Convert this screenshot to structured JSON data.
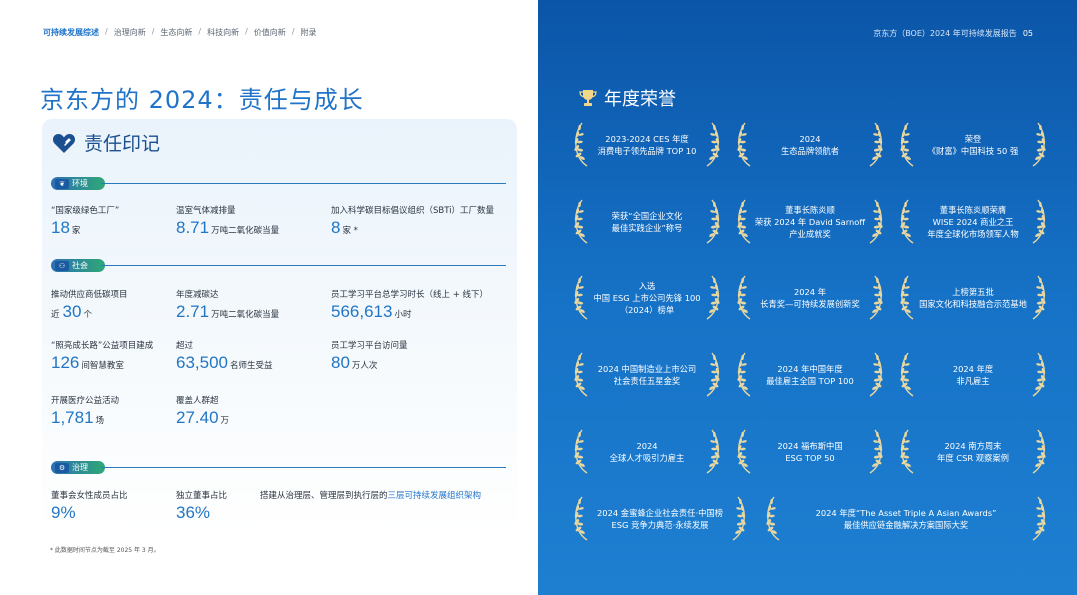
{
  "breadcrumb": {
    "items": [
      "可持续发展综述",
      "治理向新",
      "生态向新",
      "科技向新",
      "价值向新",
      "附录"
    ],
    "separator": "/"
  },
  "page_title": "京东方的 2024：责任与成长",
  "panel": {
    "title": "责任印记",
    "sections": {
      "env": {
        "label": "环境",
        "stats": [
          {
            "label": "“国家级绿色工厂”",
            "value": "18",
            "unit": "家"
          },
          {
            "label": "温室气体减排量",
            "value": "8.71",
            "unit": "万吨二氧化碳当量"
          },
          {
            "label": "加入科学碳目标倡议组织（SBTi）工厂数量",
            "value": "8",
            "unit": "家 *"
          }
        ]
      },
      "social": {
        "label": "社会",
        "stats": [
          {
            "label": "推动供应商低碳项目",
            "prefix": "近",
            "value": "30",
            "unit": "个"
          },
          {
            "label": "年度减碳达",
            "value": "2.71",
            "unit": "万吨二氧化碳当量"
          },
          {
            "label": "员工学习平台总学习时长（线上 + 线下）",
            "value": "566,613",
            "unit": "小时"
          },
          {
            "label": "“照亮成长路”公益项目建成",
            "value": "126",
            "unit": "间智慧教室"
          },
          {
            "label": "超过",
            "value": "63,500",
            "unit": "名师生受益"
          },
          {
            "label": "员工学习平台访问量",
            "value": "80",
            "unit": "万人次"
          },
          {
            "label": "开展医疗公益活动",
            "value": "1,781",
            "unit": "场"
          },
          {
            "label": "覆盖人群超",
            "value": "27.40",
            "unit": "万"
          }
        ]
      },
      "gov": {
        "label": "治理",
        "stats": [
          {
            "label": "董事会女性成员占比",
            "value": "9%"
          },
          {
            "label": "独立董事占比",
            "value": "36%"
          }
        ],
        "note_prefix": "搭建从治理层、管理层到执行层的",
        "note_highlight": "三层可持续发展组织架构"
      }
    }
  },
  "footnote": "* 此数据时间节点为截至 2025 年 3 月。",
  "right_header": {
    "text": "京东方（BOE）2024 年可持续发展报告",
    "page": "05"
  },
  "awards_title": "年度荣誉",
  "awards": [
    "2023-2024 CES 年度\n消费电子领先品牌 TOP 10",
    "2024\n生态品牌领航者",
    "荣登\n《财富》中国科技 50 强",
    "荣获“全国企业文化\n最佳实践企业”称号",
    "董事长陈炎顺\n荣获 2024 年 David Sarnoff\n产业成就奖",
    "董事长陈炎顺荣膺\nWISE 2024 商业之王\n年度全球化市场领军人物",
    "入选\n中国 ESG 上市公司先锋 100\n（2024）榜单",
    "2024 年\n长青奖—可持续发展创新奖",
    "上榜第五批\n国家文化和科技融合示范基地",
    "2024 中国制造业上市公司\n社会责任五星金奖",
    "2024 年中国年度\n最佳雇主全国 TOP 100",
    "2024 年度\n非凡雇主",
    "2024\n全球人才吸引力雇主",
    "2024 福布斯中国\nESG TOP 50",
    "2024 南方周末\n年度 CSR 观察案例",
    "2024 金蜜蜂企业社会责任·中国榜\nESG 竞争力典范·永续发展",
    "2024 年度“The Asset Triple A Asian Awards”\n最佳供应链金融解决方案国际大奖"
  ],
  "colors": {
    "accent": "#1f73c8",
    "right_bg": "#0b55a8",
    "wreath": "#e8d7a0"
  }
}
